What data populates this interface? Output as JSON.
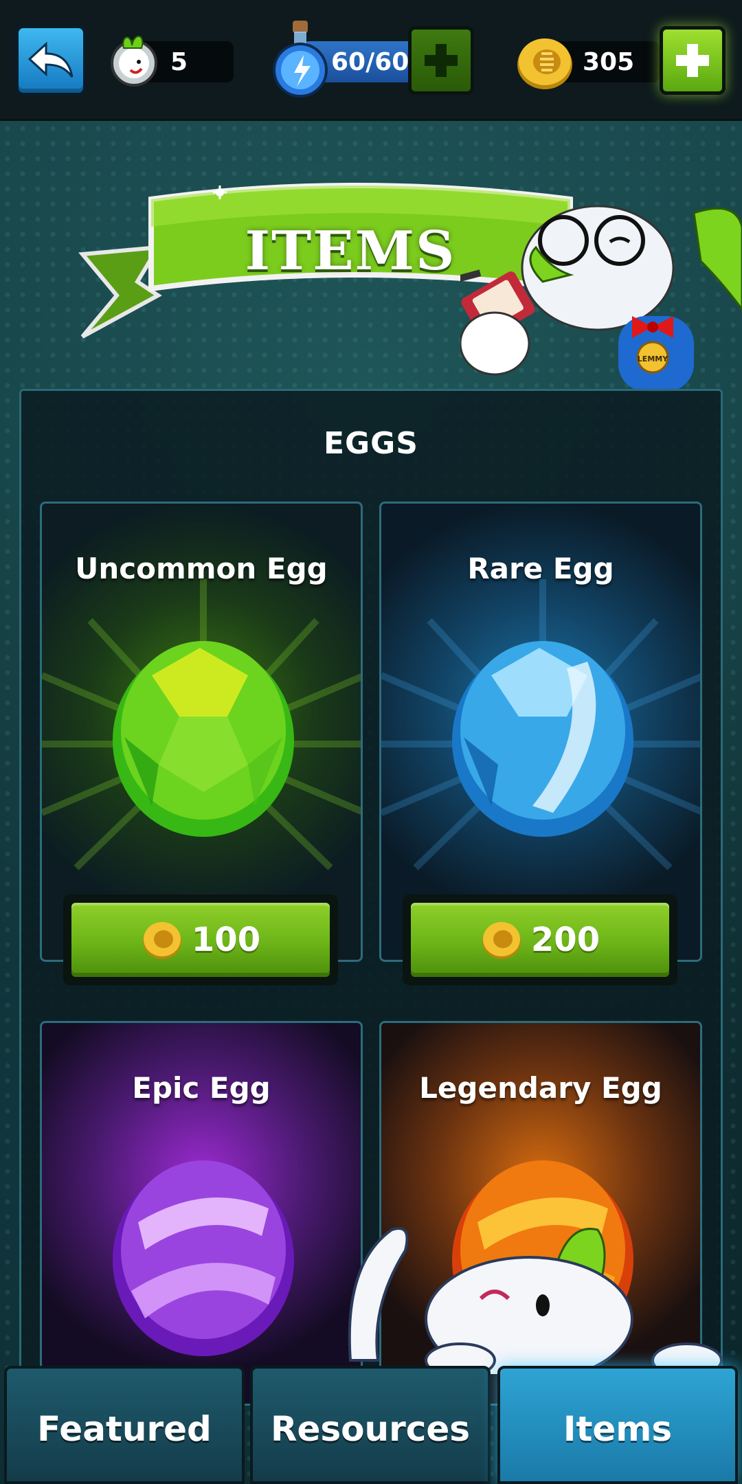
{
  "topbar": {
    "lives_count": "5",
    "energy": "60/60",
    "coins": "305"
  },
  "banner": {
    "title": "ITEMS"
  },
  "mascot": {
    "badge": "LEMMY"
  },
  "section": {
    "title": "EGGS"
  },
  "cards": [
    {
      "name": "Uncommon Egg",
      "price": "100"
    },
    {
      "name": "Rare Egg",
      "price": "200"
    },
    {
      "name": "Epic Egg"
    },
    {
      "name": "Legendary Egg"
    }
  ],
  "tabs": {
    "featured": "Featured",
    "resources": "Resources",
    "items": "Items",
    "active": "Items"
  },
  "colors": {
    "accent_green": "#6cb418",
    "tab_active": "#2ea4d4",
    "panel_border": "#2a6a78"
  }
}
